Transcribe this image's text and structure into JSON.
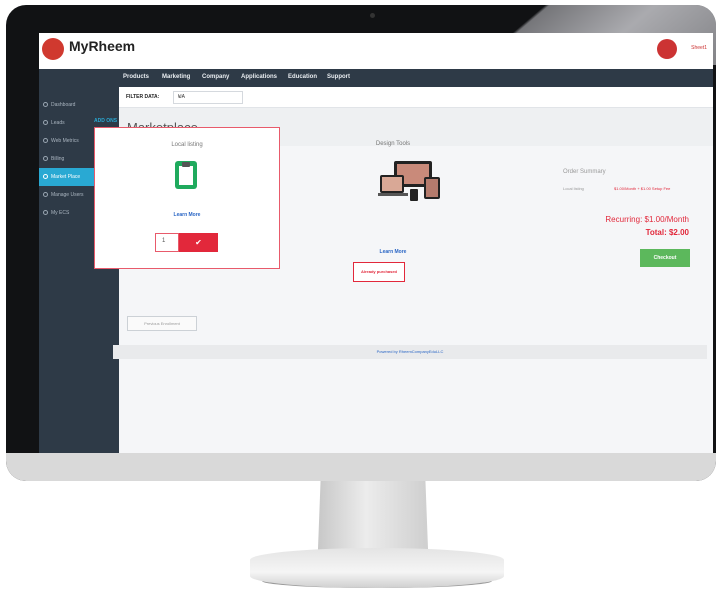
{
  "app": {
    "name": "MyRheem",
    "user_link": "Sheet1"
  },
  "nav": {
    "items": [
      "Products",
      "Marketing",
      "Company",
      "Applications",
      "Education",
      "Support"
    ]
  },
  "sidebar": {
    "items": [
      {
        "label": "Dashboard"
      },
      {
        "label": "Leads"
      },
      {
        "label": "Web Metrics"
      },
      {
        "label": "Billing"
      },
      {
        "label": "Market Place",
        "active": true
      },
      {
        "label": "Manage Users"
      },
      {
        "label": "My ECS"
      }
    ]
  },
  "filter": {
    "label": "FILTER DATA:",
    "value": "UA"
  },
  "page": {
    "title": "Marketplace",
    "section_tag": "ADD ONS"
  },
  "cards": [
    {
      "title": "Local listing",
      "icon": "clipboard-icon",
      "learn_more": "Learn More",
      "qty": "1",
      "action": "✔"
    },
    {
      "title": "Design Tools",
      "icon": "devices-icon",
      "learn_more": "Learn More",
      "status": "Already purchased"
    }
  ],
  "summary": {
    "title": "Order Summary",
    "item_label": "Local listing",
    "item_price": "$1.00/Month + $1.00 Setup Fee",
    "recurring": "Recurring: $1.00/Month",
    "total": "Total: $2.00",
    "checkout": "Checkout"
  },
  "buttons": {
    "previous": "Previous Enrollment"
  },
  "footer": {
    "text": "Powered by RheemCompanyEduLLC"
  },
  "colors": {
    "accent": "#29a9d3",
    "danger": "#e2283b",
    "success": "#5cb85c",
    "nav": "#2e3a47"
  }
}
